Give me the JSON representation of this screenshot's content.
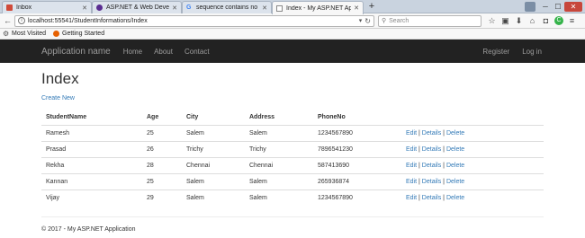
{
  "browser": {
    "tabs": [
      {
        "label": "Inbox",
        "icon": "mail-icon",
        "color": "#d04a3a"
      },
      {
        "label": "ASP.NET & Web Developm...",
        "icon": "aspnet-icon",
        "color": "#5a2d91"
      },
      {
        "label": "sequence contains no ele...",
        "icon": "google-icon",
        "color": "#4285f4"
      },
      {
        "label": "Index - My ASP.NET Applic...",
        "icon": "page-icon",
        "color": "#888888",
        "active": true
      }
    ],
    "new_tab": "+",
    "url": "localhost:55541/StudentInformations/Index",
    "search_placeholder": "Search",
    "bookmarks": [
      {
        "label": "Most Visited",
        "icon": "gear-icon"
      },
      {
        "label": "Getting Started",
        "icon": "firefox-icon"
      }
    ]
  },
  "site": {
    "brand": "Application name",
    "nav": [
      "Home",
      "About",
      "Contact"
    ],
    "nav_right": [
      "Register",
      "Log in"
    ],
    "page_title": "Index",
    "create_link": "Create New",
    "table": {
      "headers": [
        "StudentName",
        "Age",
        "City",
        "Address",
        "PhoneNo"
      ],
      "rows": [
        {
          "name": "Ramesh",
          "age": "25",
          "city": "Salem",
          "address": "Salem",
          "phone": "1234567890"
        },
        {
          "name": "Prasad",
          "age": "26",
          "city": "Trichy",
          "address": "Trichy",
          "phone": "7896541230"
        },
        {
          "name": "Rekha",
          "age": "28",
          "city": "Chennai",
          "address": "Chennai",
          "phone": "587413690"
        },
        {
          "name": "Kannan",
          "age": "25",
          "city": "Salem",
          "address": "Salem",
          "phone": "265936874"
        },
        {
          "name": "Vijay",
          "age": "29",
          "city": "Salem",
          "address": "Salem",
          "phone": "1234567890"
        }
      ],
      "actions": {
        "edit": "Edit",
        "details": "Details",
        "delete": "Delete",
        "separator": "|"
      }
    },
    "footer": "© 2017 - My ASP.NET Application"
  }
}
